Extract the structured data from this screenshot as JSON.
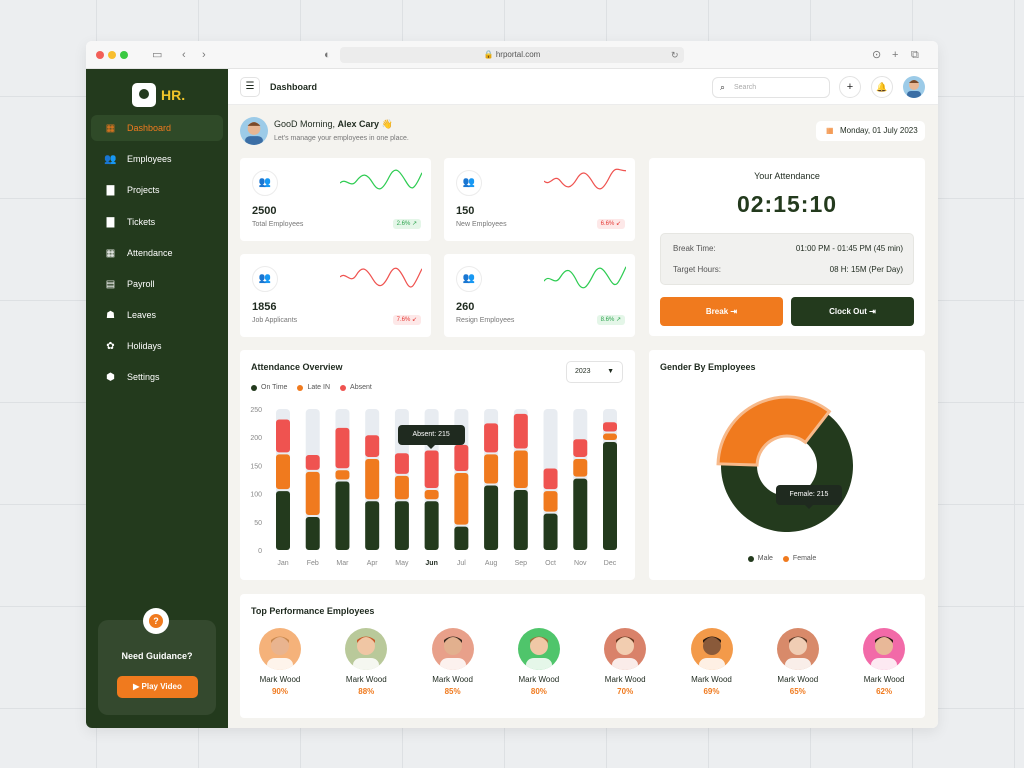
{
  "browser": {
    "url": "hrportal.com"
  },
  "app": {
    "logo": "HR."
  },
  "sidebar": {
    "items": [
      {
        "label": "Dashboard",
        "icon": "grid-icon",
        "glyph": "▦",
        "active": true
      },
      {
        "label": "Employees",
        "icon": "users-icon",
        "glyph": "👥",
        "active": false
      },
      {
        "label": "Projects",
        "icon": "file-icon",
        "glyph": "▇",
        "active": false
      },
      {
        "label": "Tickets",
        "icon": "ticket-icon",
        "glyph": "▇",
        "active": false
      },
      {
        "label": "Attendance",
        "icon": "calendar-icon",
        "glyph": "▦",
        "active": false
      },
      {
        "label": "Payroll",
        "icon": "receipt-icon",
        "glyph": "▤",
        "active": false
      },
      {
        "label": "Leaves",
        "icon": "leaf-icon",
        "glyph": "☗",
        "active": false
      },
      {
        "label": "Holidays",
        "icon": "holiday-icon",
        "glyph": "✿",
        "active": false
      },
      {
        "label": "Settings",
        "icon": "gear-icon",
        "glyph": "⬢",
        "active": false
      }
    ],
    "guidance": {
      "title": "Need Guidance?",
      "button": "Play Video"
    }
  },
  "header": {
    "title": "Dashboard",
    "search_placeholder": "Search"
  },
  "greeting": {
    "prefix": "GooD Morning, ",
    "name": "Alex Cary",
    "wave": "👋",
    "subtitle": "Let's manage your employees in one place.",
    "date": "Monday, 01 July 2023"
  },
  "kpis": [
    {
      "value": "2500",
      "label": "Total Employees",
      "change": "2.6%",
      "arrow": "↗",
      "trend": "up",
      "color": "#2ecc52"
    },
    {
      "value": "150",
      "label": "New Employees",
      "change": "6.6%",
      "arrow": "↙",
      "trend": "down",
      "color": "#ef5350"
    },
    {
      "value": "1856",
      "label": "Job Applicants",
      "change": "7.6%",
      "arrow": "↙",
      "trend": "down",
      "color": "#ef5350"
    },
    {
      "value": "260",
      "label": "Resign Employees",
      "change": "8.6%",
      "arrow": "↗",
      "trend": "up",
      "color": "#2ecc52"
    }
  ],
  "attendance": {
    "title": "Your Attendance",
    "time": "02:15:10",
    "break_label": "Break Time:",
    "break_value": "01:00 PM - 01:45 PM (45 min)",
    "target_label": "Target Hours:",
    "target_value": "08 H: 15M (Per Day)",
    "break_button": "Break",
    "clockout_button": "Clock Out"
  },
  "overview": {
    "title": "Attendance Overview",
    "year": "2023",
    "tooltip": "Absent: 215"
  },
  "gender": {
    "title": "Gender By Employees",
    "tooltip": "Female: 215"
  },
  "top": {
    "title": "Top Performance Employees",
    "employees": [
      {
        "name": "Mark Wood",
        "pct": "90%",
        "bg": "#f5b27a",
        "skin": "#e9b48f",
        "hair": "#c9894f"
      },
      {
        "name": "Mark Wood",
        "pct": "88%",
        "bg": "#b9c99a",
        "skin": "#f0c6a4",
        "hair": "#c75a2a"
      },
      {
        "name": "Mark Wood",
        "pct": "85%",
        "bg": "#e8a08a",
        "skin": "#e2b08e",
        "hair": "#3a2a20"
      },
      {
        "name": "Mark Wood",
        "pct": "80%",
        "bg": "#4fc56b",
        "skin": "#f0c8a6",
        "hair": "#a0703a"
      },
      {
        "name": "Mark Wood",
        "pct": "70%",
        "bg": "#d9826a",
        "skin": "#f2cdb0",
        "hair": "#6a3a22"
      },
      {
        "name": "Mark Wood",
        "pct": "69%",
        "bg": "#f39a4a",
        "skin": "#8a5a3a",
        "hair": "#2a1a10"
      },
      {
        "name": "Mark Wood",
        "pct": "65%",
        "bg": "#d88a6a",
        "skin": "#f0cdb4",
        "hair": "#5a3a28"
      },
      {
        "name": "Mark Wood",
        "pct": "62%",
        "bg": "#f26aa8",
        "skin": "#e8b898",
        "hair": "#2a1a14"
      }
    ]
  },
  "colors": {
    "dark": "#233a1d",
    "orange": "#f07a1e",
    "red": "#ef5350",
    "track": "#e8ecf1"
  },
  "chart_data": [
    {
      "type": "bar",
      "stacked": true,
      "categories": [
        "Jan",
        "Feb",
        "Mar",
        "Apr",
        "May",
        "Jun",
        "Jul",
        "Aug",
        "Sep",
        "Oct",
        "Nov",
        "Dec"
      ],
      "series": [
        {
          "name": "On Time",
          "color": "#233a1d",
          "values": [
            108,
            62,
            125,
            90,
            90,
            90,
            45,
            118,
            110,
            68,
            130,
            195
          ]
        },
        {
          "name": "Late IN",
          "color": "#f07a1e",
          "values": [
            65,
            80,
            20,
            75,
            45,
            20,
            95,
            55,
            70,
            40,
            35,
            15
          ]
        },
        {
          "name": "Absent",
          "color": "#ef5350",
          "values": [
            62,
            30,
            75,
            42,
            40,
            70,
            50,
            55,
            65,
            40,
            35,
            20
          ]
        }
      ],
      "ylim": [
        0,
        250
      ],
      "yticks": [
        0,
        50,
        100,
        150,
        200,
        250
      ],
      "highlight": "Jun",
      "legend": "top-left",
      "grid": false
    },
    {
      "type": "pie",
      "donut": true,
      "labels": [
        "Male",
        "Female"
      ],
      "values": [
        65,
        35
      ],
      "colors": [
        "#233a1d",
        "#f07a1e"
      ],
      "legend": "bottom"
    }
  ]
}
